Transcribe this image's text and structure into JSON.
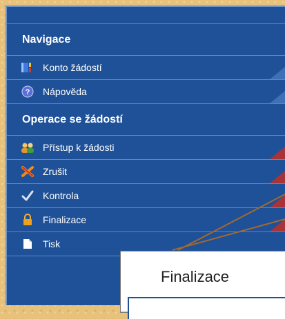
{
  "sidebar": {
    "section_nav": {
      "title": "Navigace",
      "items": [
        {
          "label": "Konto žádostí",
          "icon": "accounts-icon"
        },
        {
          "label": "Nápověda",
          "icon": "help-icon"
        }
      ]
    },
    "section_ops": {
      "title": "Operace se žádostí",
      "items": [
        {
          "label": "Přístup k žádosti",
          "icon": "users-icon"
        },
        {
          "label": "Zrušit",
          "icon": "cancel-icon"
        },
        {
          "label": "Kontrola",
          "icon": "checkmark-icon"
        },
        {
          "label": "Finalizace",
          "icon": "lock-icon"
        },
        {
          "label": "Tisk",
          "icon": "document-icon"
        }
      ]
    }
  },
  "callout": {
    "title": "Finalizace"
  },
  "colors": {
    "panel": "#1f5198",
    "accent_red": "#a8343a",
    "background": "#e8c27a",
    "callout_line": "#a36a2c"
  }
}
